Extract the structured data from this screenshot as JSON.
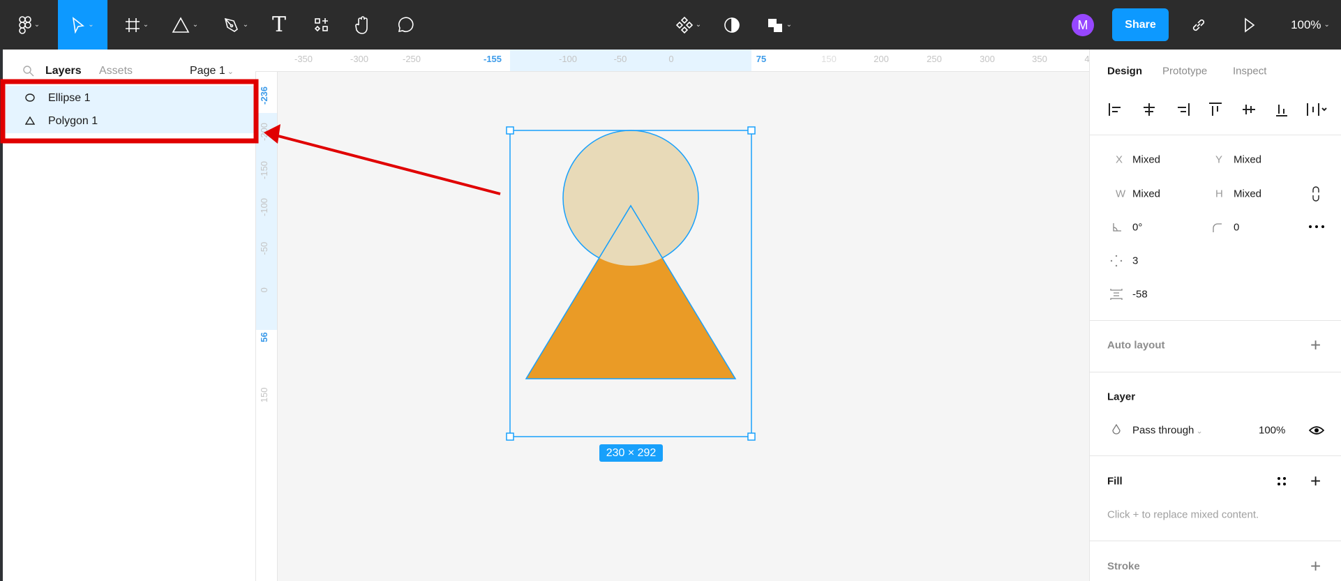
{
  "toolbar": {
    "share_label": "Share",
    "avatar_initial": "M",
    "zoom": "100%",
    "text_tool": "T"
  },
  "left_panel": {
    "tabs": [
      "Layers",
      "Assets"
    ],
    "page": "Page 1",
    "layers": [
      {
        "name": "Ellipse 1",
        "icon": "ellipse-icon"
      },
      {
        "name": "Polygon 1",
        "icon": "triangle-icon"
      }
    ]
  },
  "rulers": {
    "horizontal": [
      "-350",
      "-300",
      "-250",
      "-155",
      "-100",
      "-50",
      "0",
      "75",
      "150",
      "200",
      "250",
      "300",
      "350",
      "4"
    ],
    "vertical": [
      "-236",
      "-200",
      "-150",
      "-100",
      "-50",
      "0",
      "56",
      "150"
    ]
  },
  "canvas": {
    "selection_size": "230 × 292",
    "colors": {
      "ellipse": "#e8dab8",
      "polygon": "#ea9b26",
      "selection": "#18a0fb",
      "annotation": "#e00000"
    }
  },
  "right_panel": {
    "tabs": [
      "Design",
      "Prototype",
      "Inspect"
    ],
    "x_label": "X",
    "x": "Mixed",
    "y_label": "Y",
    "y": "Mixed",
    "w_label": "W",
    "w": "Mixed",
    "h_label": "H",
    "h": "Mixed",
    "rotation": "0°",
    "radius": "0",
    "points": "3",
    "spacing": "-58",
    "auto_layout": "Auto layout",
    "layer": "Layer",
    "blend": "Pass through",
    "opacity": "100%",
    "fill": "Fill",
    "fill_hint": "Click + to replace mixed content.",
    "stroke": "Stroke"
  }
}
